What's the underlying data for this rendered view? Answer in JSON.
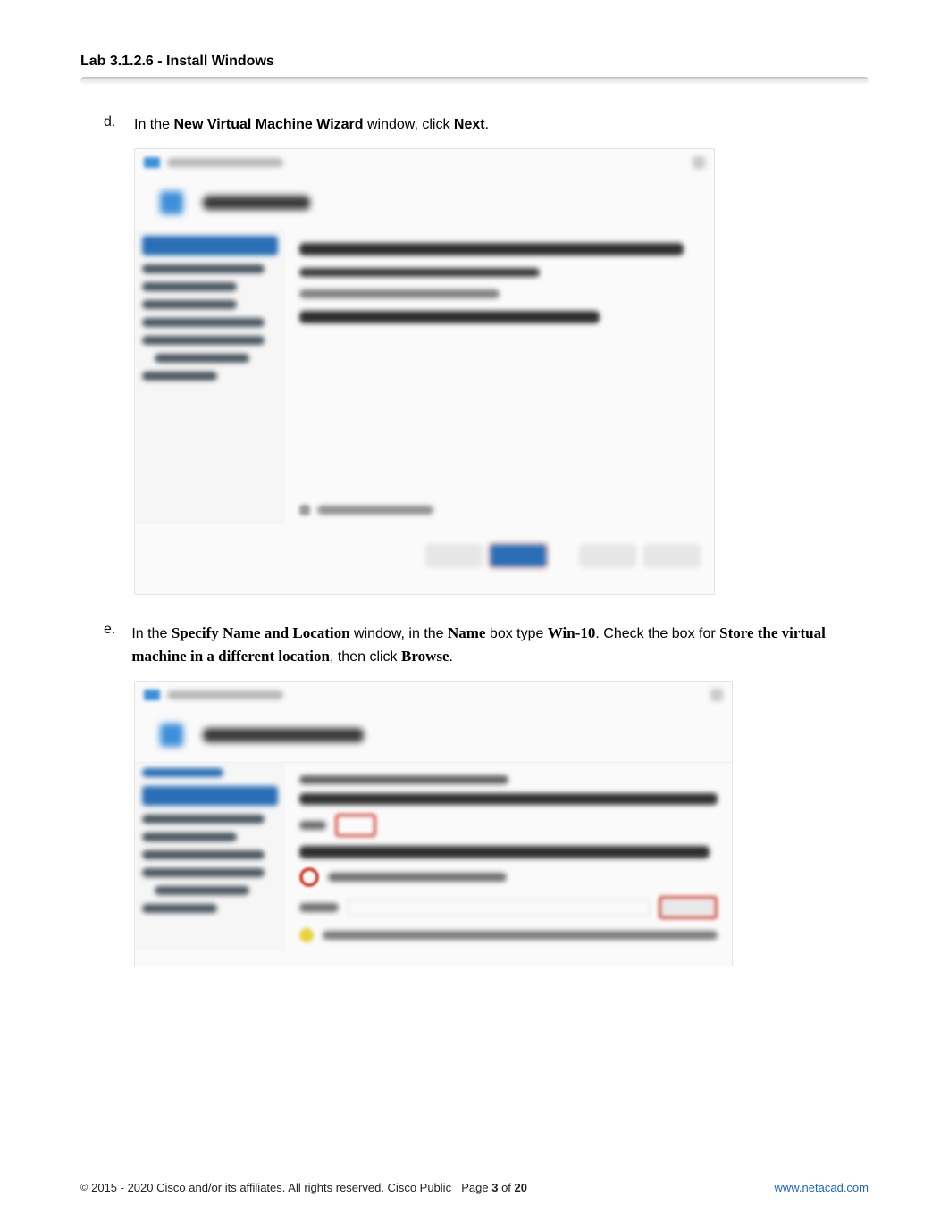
{
  "header": {
    "title": "Lab 3.1.2.6 - Install Windows"
  },
  "steps": {
    "d": {
      "label": "d.",
      "parts": {
        "p1": "In the ",
        "b1": "New Virtual Machine Wizard",
        "p2": " window, click ",
        "b2": "Next",
        "p3": "."
      }
    },
    "e": {
      "label": "e.",
      "parts": {
        "p1": "In the ",
        "b1": "Specify Name and Location",
        "p2": " window, in the ",
        "b2": "Name",
        "p3": " box type ",
        "b3": "Win-10",
        "p4": ". Check the box for ",
        "b4": "Store the virtual machine in a different location",
        "p5": ", then click ",
        "b5": "Browse",
        "p6": "."
      }
    }
  },
  "footer": {
    "copyright_symbol": "©",
    "copyright": "2015 - 2020 Cisco and/or its affiliates. All rights reserved. Cisco Public",
    "page_prefix": "Page ",
    "page_current": "3",
    "page_of": " of ",
    "page_total": "20",
    "link_text": "www.netacad.com"
  }
}
